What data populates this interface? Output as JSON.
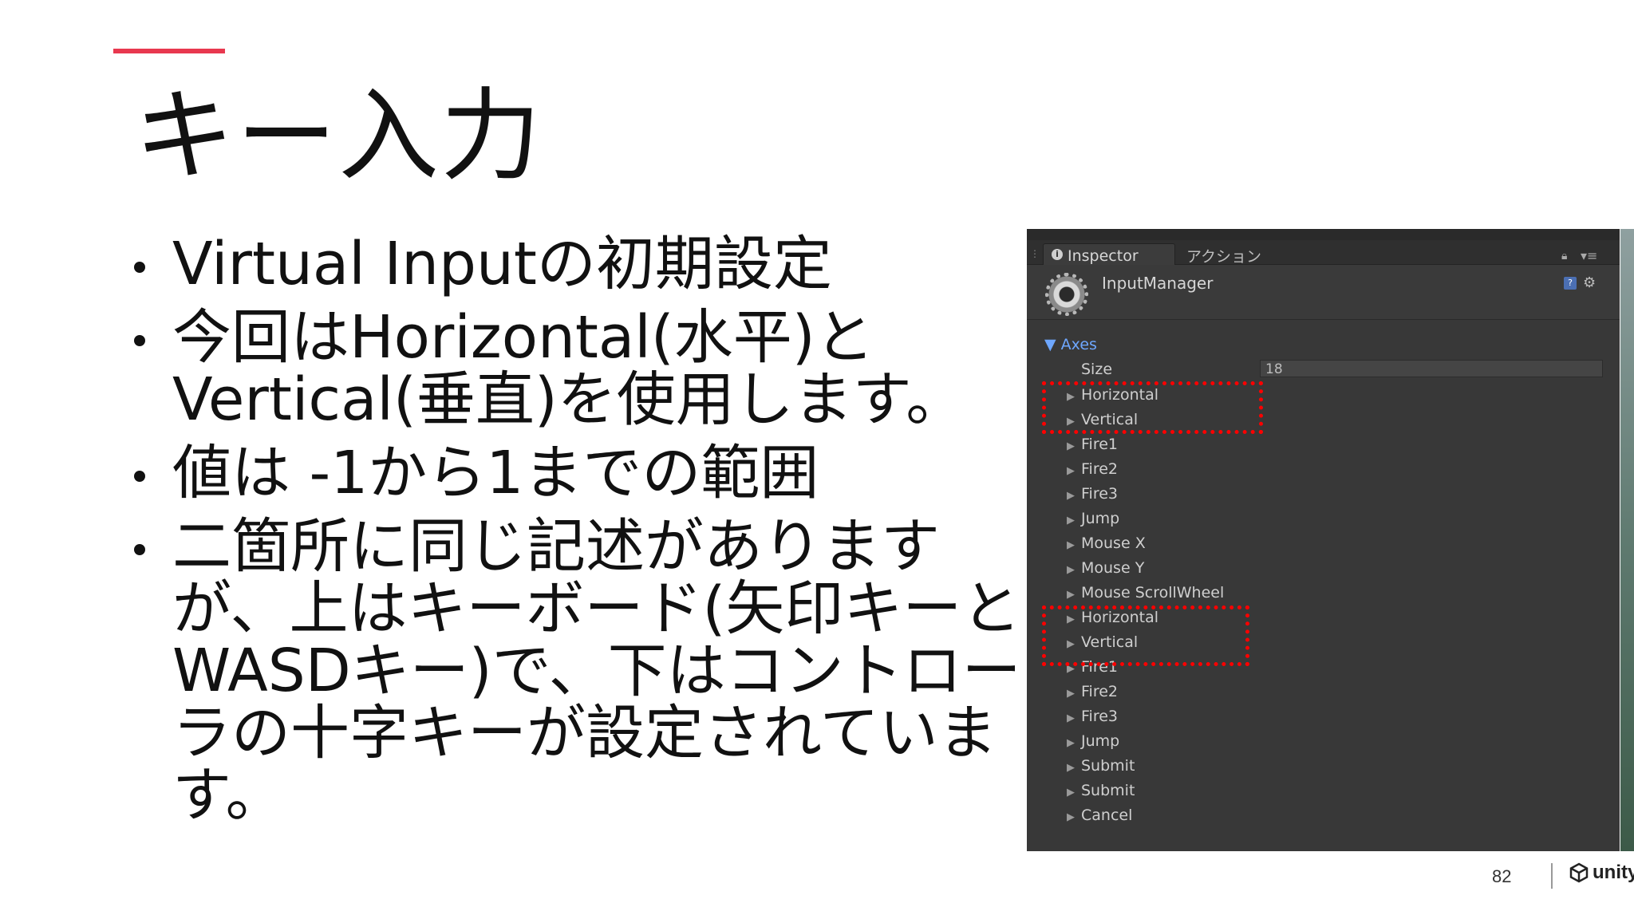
{
  "slide": {
    "title": "キー入力",
    "bullets": [
      "Virtual Inputの初期設定",
      "今回はHorizontal(水平)とVertical(垂直)を使用します。",
      "値は -1から1までの範囲",
      "二箇所に同じ記述がありますが、上はキーボード(矢印キーとWASDキー)で、下はコントローラの十字キーが設定されています。"
    ],
    "page_number": "82",
    "logo_text": "unity",
    "accent_color": "#e8384f"
  },
  "inspector": {
    "tabs": [
      "Inspector",
      "アクション"
    ],
    "object_name": "InputManager",
    "axes_label": "Axes",
    "size_label": "Size",
    "size_value": "18",
    "axes": [
      "Horizontal",
      "Vertical",
      "Fire1",
      "Fire2",
      "Fire3",
      "Jump",
      "Mouse X",
      "Mouse Y",
      "Mouse ScrollWheel",
      "Horizontal",
      "Vertical",
      "Fire1",
      "Fire2",
      "Fire3",
      "Jump",
      "Submit",
      "Submit",
      "Cancel"
    ],
    "highlight_color": "#ff0000"
  }
}
